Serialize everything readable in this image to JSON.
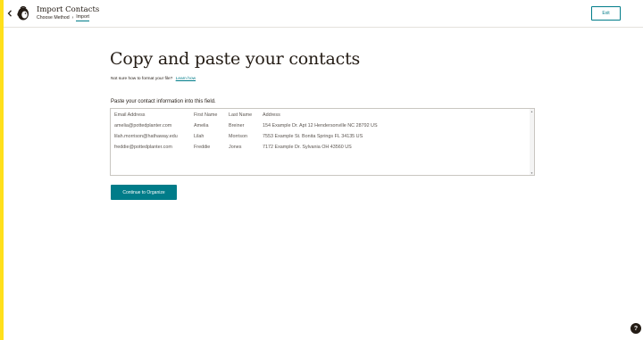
{
  "header": {
    "title": "Import Contacts",
    "breadcrumb": {
      "step1": "Choose Method",
      "step2": "Import"
    },
    "exit_label": "Exit"
  },
  "main": {
    "title": "Copy and paste your contacts",
    "help_text": "Not sure how to format your file?",
    "help_link": "Learn how",
    "paste_label": "Paste your contact information into this field.",
    "paste_rows": [
      [
        "Email Address",
        "First Name",
        "Last Name",
        "Address"
      ],
      [
        "amelia@pottedplanter.com",
        "Amelia",
        "Breiner",
        "154 Example Dr. Apt 12 Hendersonville NC 28792 US"
      ],
      [
        "lilah.morrison@hathaway.edu",
        "Lilah",
        "Morrison",
        "7553 Example St. Bonita Springs FL 34135 US"
      ],
      [
        "freddie@pottedplanter.com",
        "Freddie",
        "Jones",
        "7172 Example Dr. Sylvania OH 43560 US"
      ]
    ],
    "continue_label": "Continue to Organize"
  },
  "help_fab_label": "?",
  "colors": {
    "accent_bar": "#ffe01b",
    "primary": "#007c89",
    "text": "#241c15"
  },
  "icons": {
    "back": "chevron-left-icon",
    "logo": "mailchimp-logo-icon",
    "help": "help-icon"
  }
}
